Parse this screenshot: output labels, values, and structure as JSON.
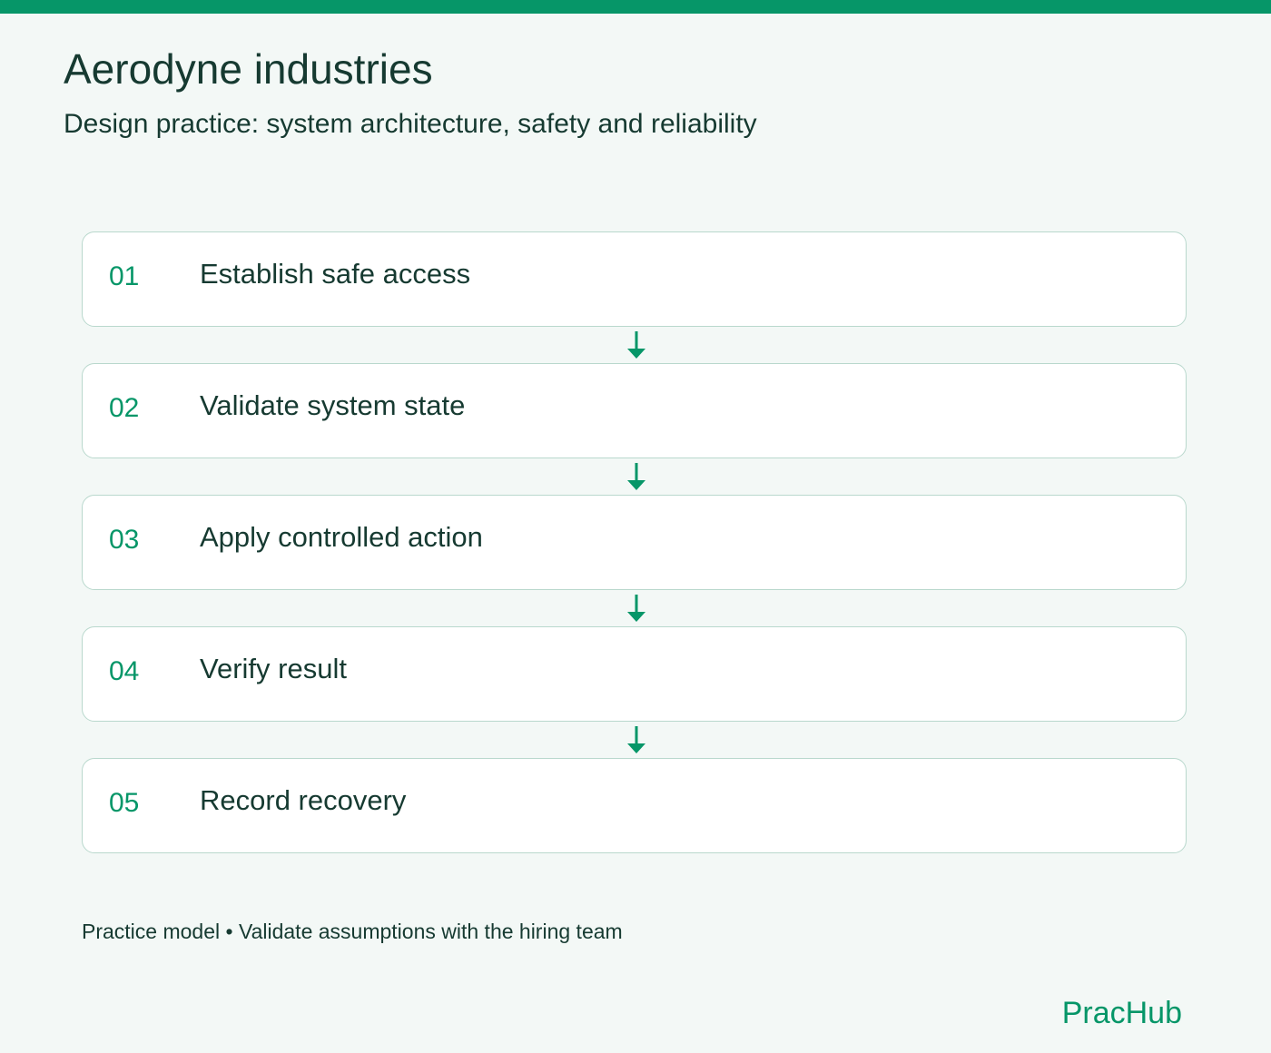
{
  "header": {
    "title": "Aerodyne industries",
    "subtitle": "Design practice: system architecture, safety and reliability"
  },
  "steps": [
    {
      "number": "01",
      "label": "Establish safe access"
    },
    {
      "number": "02",
      "label": "Validate system state"
    },
    {
      "number": "03",
      "label": "Apply controlled action"
    },
    {
      "number": "04",
      "label": "Verify result"
    },
    {
      "number": "05",
      "label": "Record recovery"
    }
  ],
  "footer": {
    "note": "Practice model • Validate assumptions with the hiring team",
    "brand": "PracHub"
  },
  "colors": {
    "accent": "#069668",
    "text": "#163a31",
    "background": "#f3f8f6",
    "card_border": "#b9d8cd"
  },
  "icons": {
    "connector": "arrow-down-icon"
  }
}
